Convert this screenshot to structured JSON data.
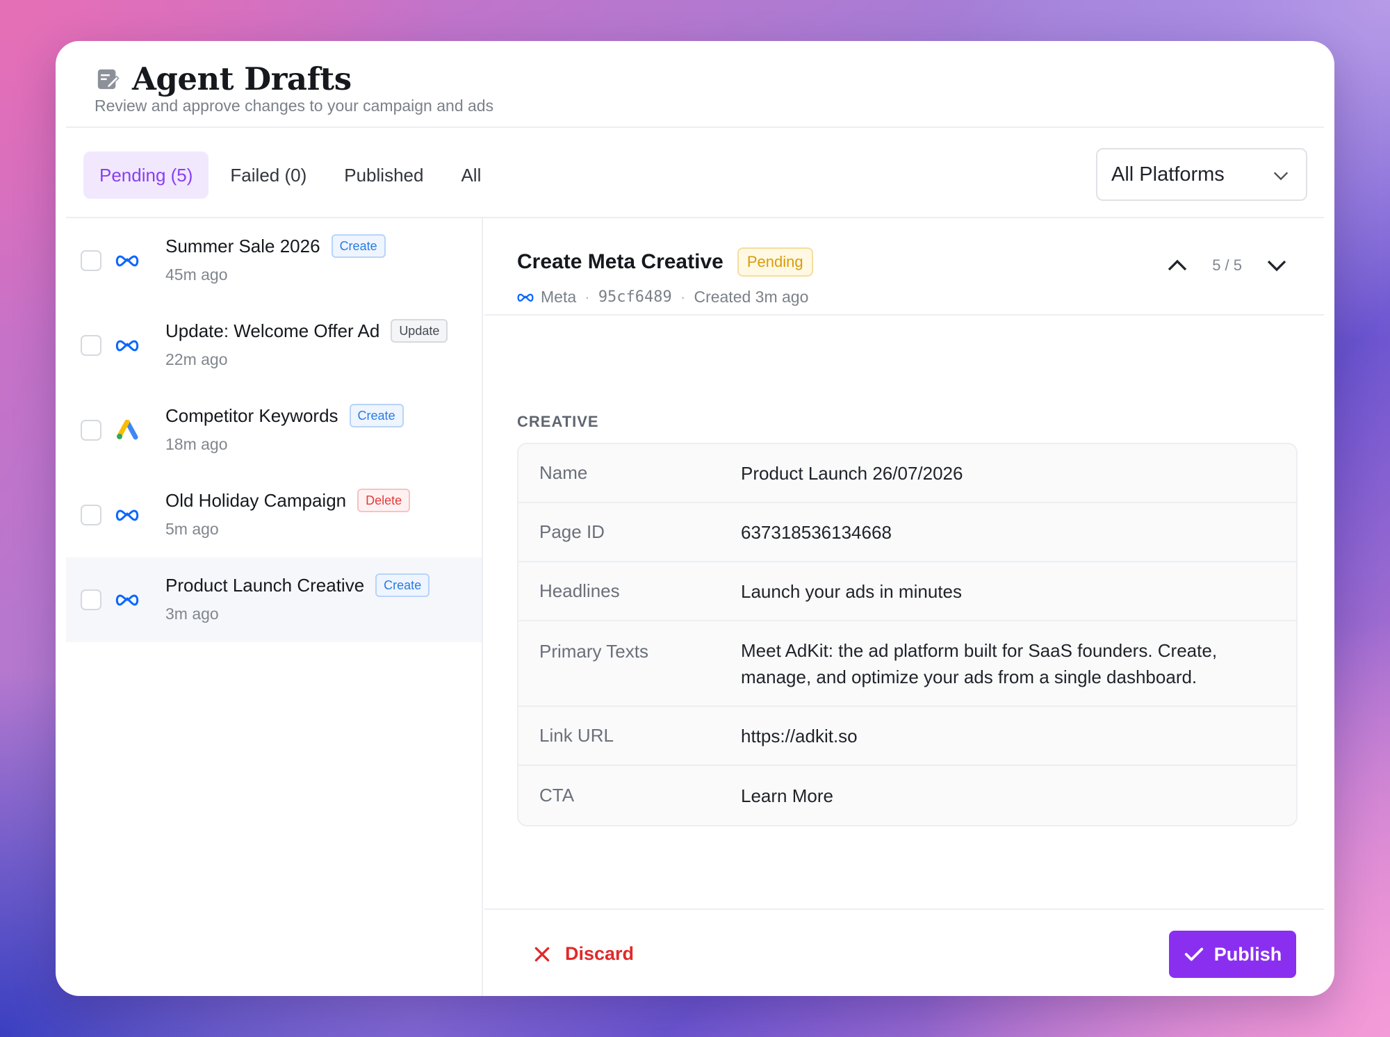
{
  "header": {
    "title": "Agent Drafts",
    "subtitle": "Review and approve changes to your campaign and ads",
    "icon": "edit-note-icon"
  },
  "tabs": [
    {
      "label": "Pending (5)",
      "active": true
    },
    {
      "label": "Failed (0)",
      "active": false
    },
    {
      "label": "Published",
      "active": false
    },
    {
      "label": "All",
      "active": false
    }
  ],
  "platform_filter": {
    "selected": "All Platforms"
  },
  "drafts": [
    {
      "name": "Summer Sale 2026",
      "badge": "Create",
      "time": "45m ago",
      "platform": "meta"
    },
    {
      "name": "Update: Welcome Offer Ad",
      "badge": "Update",
      "time": "22m ago",
      "platform": "meta"
    },
    {
      "name": "Competitor Keywords",
      "badge": "Create",
      "time": "18m ago",
      "platform": "google-ads"
    },
    {
      "name": "Old Holiday Campaign",
      "badge": "Delete",
      "time": "5m ago",
      "platform": "meta"
    },
    {
      "name": "Product Launch Creative",
      "badge": "Create",
      "time": "3m ago",
      "platform": "meta",
      "selected": true
    }
  ],
  "detail": {
    "title": "Create Meta Creative",
    "status": "Pending",
    "platform": "Meta",
    "id": "95cf6489",
    "created": "Created 3m ago",
    "position": "5 / 5",
    "section_label": "CREATIVE",
    "fields": [
      {
        "key": "Name",
        "value": "Product Launch 26/07/2026"
      },
      {
        "key": "Page ID",
        "value": "637318536134668"
      },
      {
        "key": "Headlines",
        "value": "Launch your ads in minutes"
      },
      {
        "key": "Primary Texts",
        "value": "Meet AdKit: the ad platform built for SaaS founders. Create, manage, and optimize your ads from a single dashboard."
      },
      {
        "key": "Link URL",
        "value": "https://adkit.so"
      },
      {
        "key": "CTA",
        "value": "Learn More"
      }
    ]
  },
  "actions": {
    "discard_label": "Discard",
    "publish_label": "Publish"
  },
  "colors": {
    "accent": "#8a2ff0",
    "danger": "#e02a2a",
    "pending": "#d99c0b",
    "meta_blue": "#0866ff"
  }
}
